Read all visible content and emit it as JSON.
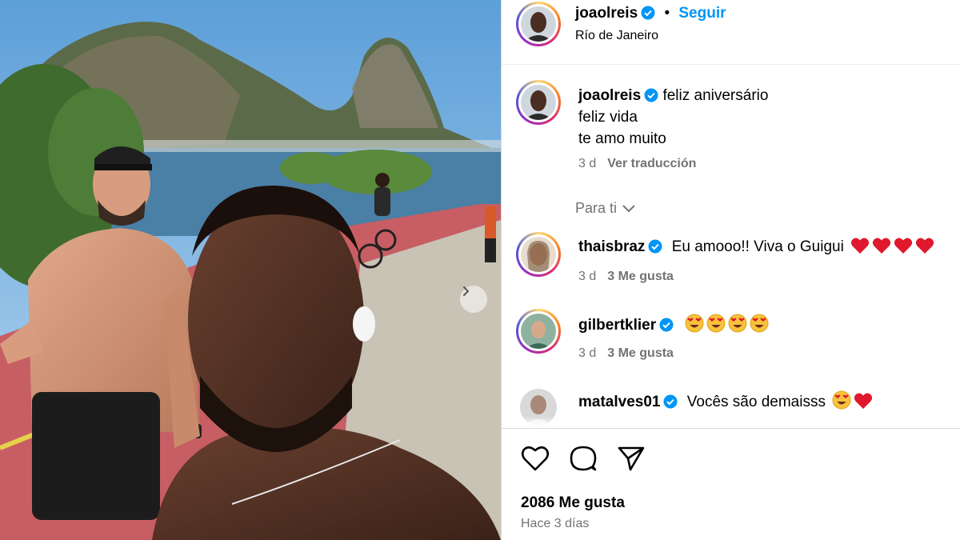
{
  "post": {
    "author": "joaolreis",
    "follow_label": "Seguir",
    "separator": "•",
    "location": "Río de Janeiro"
  },
  "caption": {
    "username": "joaolreis",
    "lines": [
      "feliz aniversário",
      "feliz vida",
      "te amo muito"
    ],
    "age": "3 d",
    "translate_label": "Ver traducción"
  },
  "section_label": "Para ti",
  "comments": [
    {
      "username": "thaisbraz",
      "text": "Eu amooo!! Viva o Guigui",
      "emoji": [
        "red-heart",
        "red-heart",
        "red-heart",
        "red-heart"
      ],
      "age": "3 d",
      "likes": "3 Me gusta"
    },
    {
      "username": "gilbertklier",
      "text": "",
      "emoji": [
        "heart-eyes",
        "heart-eyes",
        "heart-eyes",
        "heart-eyes"
      ],
      "age": "3 d",
      "likes": "3 Me gusta"
    },
    {
      "username": "matalves01",
      "text": "Vocês são demaisss",
      "emoji": [
        "heart-eyes",
        "red-heart"
      ],
      "age": "",
      "likes": ""
    }
  ],
  "footer": {
    "likes_count": "2086 Me gusta",
    "posted": "Hace 3 días"
  },
  "icons": {
    "verified": "verified-badge-icon",
    "like": "heart-outline-icon",
    "comment": "comment-bubble-icon",
    "share": "paper-plane-icon",
    "chevron": "chevron-down-icon",
    "next": "chevron-right-icon"
  },
  "colors": {
    "link_blue": "#0095f6",
    "muted": "#737373",
    "verified": "#0095f6",
    "heart_red": "#e0182d"
  }
}
